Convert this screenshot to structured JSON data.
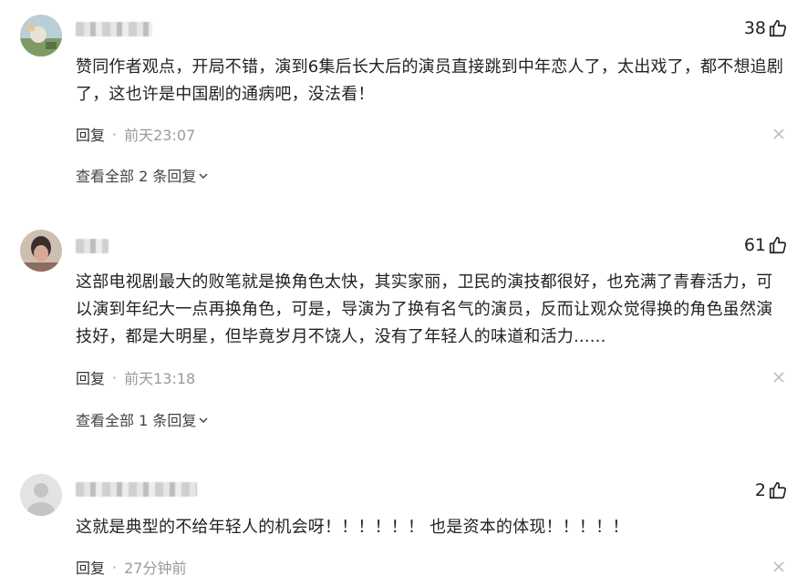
{
  "comments": [
    {
      "likes": "38",
      "text": "赞同作者观点，开局不错，演到6集后长大后的演员直接跳到中年恋人了，太出戏了，都不想追剧了，这也许是中国剧的通病吧，没法看！",
      "reply_label": "回复",
      "separator": "·",
      "time": "前天23:07",
      "view_replies": "查看全部 2 条回复"
    },
    {
      "likes": "61",
      "text": "这部电视剧最大的败笔就是换角色太快，其实家丽，卫民的演技都很好，也充满了青春活力，可以演到年纪大一点再换角色，可是，导演为了换有名气的演员，反而让观众觉得换的角色虽然演技好，都是大明星，但毕竟岁月不饶人，没有了年轻人的味道和活力......",
      "reply_label": "回复",
      "separator": "·",
      "time": "前天13:18",
      "view_replies": "查看全部 1 条回复"
    },
    {
      "likes": "2",
      "text": "这就是典型的不给年轻人的机会呀！！！！！！ 也是资本的体现！！！！！",
      "reply_label": "回复",
      "separator": "·",
      "time": "27分钟前"
    }
  ],
  "icons": {
    "like": "thumbs-up-icon",
    "close": "close-icon",
    "expand": "chevron-down-icon"
  }
}
